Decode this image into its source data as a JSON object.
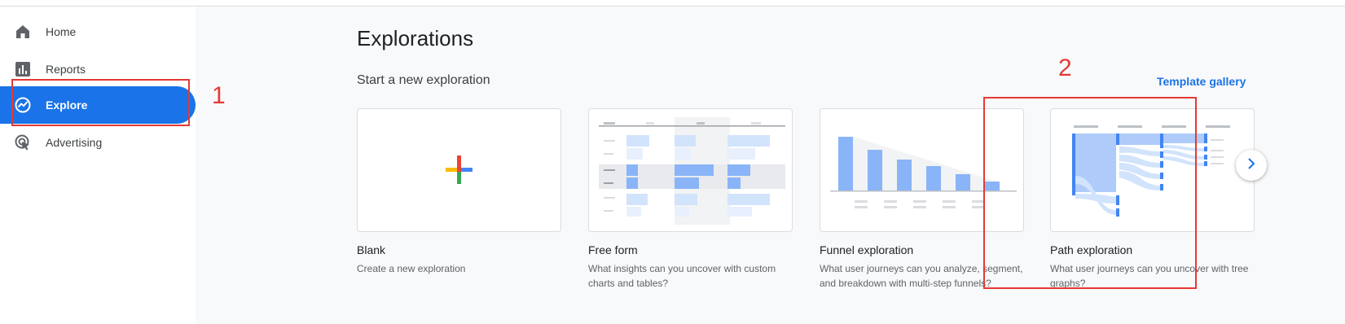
{
  "nav": {
    "items": [
      {
        "label": "Home",
        "icon": "home-icon"
      },
      {
        "label": "Reports",
        "icon": "reports-icon"
      },
      {
        "label": "Explore",
        "icon": "explore-icon",
        "active": true
      },
      {
        "label": "Advertising",
        "icon": "advertising-icon"
      }
    ]
  },
  "page": {
    "title": "Explorations",
    "subtitle": "Start a new exploration",
    "template_gallery": "Template gallery"
  },
  "cards": [
    {
      "title": "Blank",
      "desc": "Create a new exploration"
    },
    {
      "title": "Free form",
      "desc": "What insights can you uncover with custom charts and tables?"
    },
    {
      "title": "Funnel exploration",
      "desc": "What user journeys can you analyze, segment, and breakdown with multi-step funnels?"
    },
    {
      "title": "Path exploration",
      "desc": "What user journeys can you uncover with tree graphs?"
    }
  ],
  "annotations": {
    "first": "1",
    "second": "2"
  },
  "colors": {
    "accent": "#1a73e8",
    "annotation": "#e53935",
    "chart_blue": "#8ab4f8"
  }
}
